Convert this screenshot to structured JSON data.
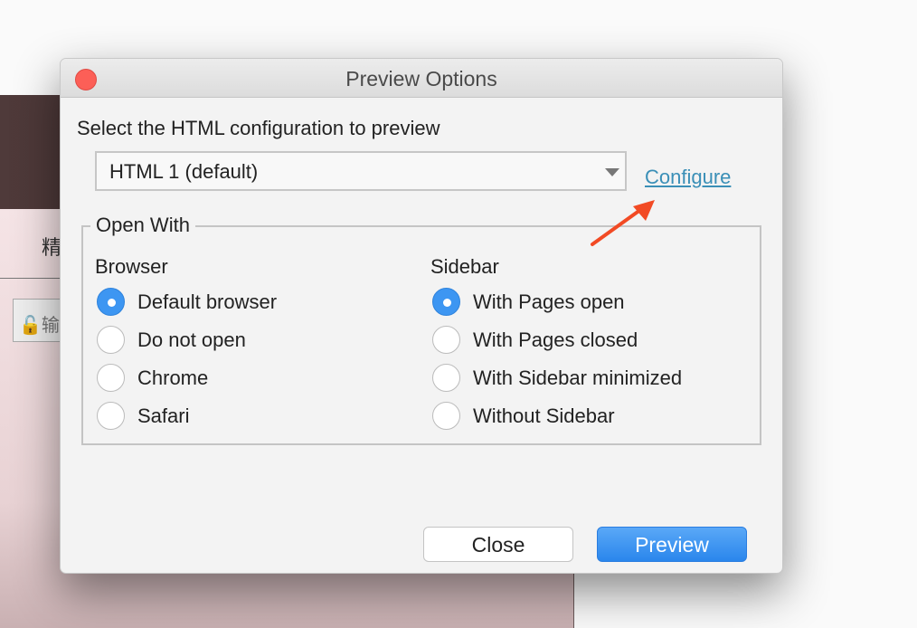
{
  "background": {
    "header_char": "精",
    "input_text": "输"
  },
  "dialog": {
    "title": "Preview Options",
    "prompt": "Select the HTML configuration to preview",
    "config_select": {
      "value": "HTML 1 (default)"
    },
    "configure_link": "Configure",
    "open_with": {
      "legend": "Open With",
      "browser": {
        "heading": "Browser",
        "options": [
          "Default browser",
          "Do not open",
          "Chrome",
          "Safari"
        ],
        "selected": 0
      },
      "sidebar": {
        "heading": "Sidebar",
        "options": [
          "With Pages open",
          "With Pages closed",
          "With Sidebar minimized",
          "Without Sidebar"
        ],
        "selected": 0
      }
    },
    "buttons": {
      "close": "Close",
      "preview": "Preview"
    }
  },
  "colors": {
    "accent": "#3d96f2",
    "link": "#3a8fb7",
    "annotation_arrow": "#f24a24",
    "close_dot": "#fc5f57"
  }
}
